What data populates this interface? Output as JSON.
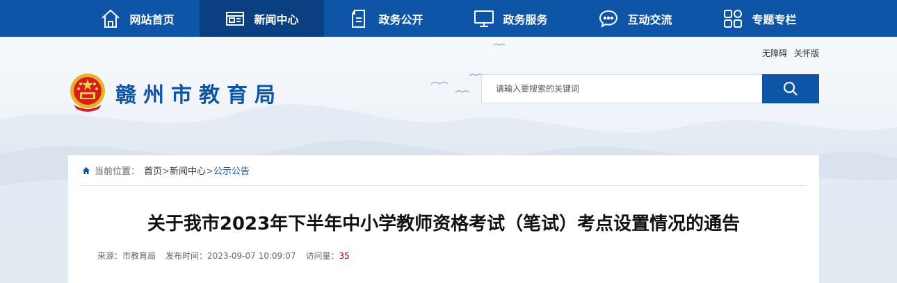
{
  "nav": {
    "items": [
      {
        "label": "网站首页",
        "icon": "home-icon"
      },
      {
        "label": "新闻中心",
        "icon": "news-icon"
      },
      {
        "label": "政务公开",
        "icon": "document-icon"
      },
      {
        "label": "政务服务",
        "icon": "monitor-icon"
      },
      {
        "label": "互动交流",
        "icon": "chat-icon"
      },
      {
        "label": "专题专栏",
        "icon": "grid-icon"
      }
    ],
    "active_index": 1
  },
  "accessibility": {
    "barrier_free": "无障碍",
    "elder_mode": "关怀版"
  },
  "site": {
    "title": "赣州市教育局",
    "emblem": "national-emblem"
  },
  "search": {
    "placeholder": "请输入要搜索的关键词"
  },
  "breadcrumb": {
    "prefix": "当前位置：",
    "items": [
      "首页",
      "新闻中心",
      "公示公告"
    ],
    "separator": ">"
  },
  "article": {
    "title": "关于我市2023年下半年中小学教师资格考试（笔试）考点设置情况的通告",
    "source_label": "来源：",
    "source": "市教育局",
    "time_label": "发布时间：",
    "time": "2023-09-07 10:09:07",
    "views_label": "访问量：",
    "views": "35"
  },
  "colors": {
    "brand": "#0f55a7",
    "nav_active": "#0a3f82",
    "view_count": "#a30000"
  }
}
